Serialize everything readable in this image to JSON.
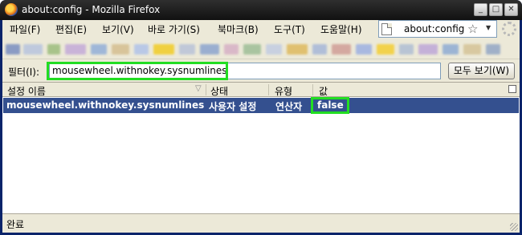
{
  "window": {
    "title": "about:config - Mozilla Firefox"
  },
  "menu": {
    "items": [
      "파일(F)",
      "편집(E)",
      "보기(V)",
      "바로 가기(S)",
      "북마크(B)",
      "도구(T)",
      "도움말(H)"
    ]
  },
  "urlbar": {
    "value": "about:config"
  },
  "filter": {
    "label": "필터(I):",
    "value": "mousewheel.withnokey.sysnumlines",
    "show_all_label": "모두 보기(W)"
  },
  "table": {
    "headers": [
      "설정 이름",
      "상태",
      "유형",
      "값"
    ],
    "rows": [
      {
        "name": "mousewheel.withnokey.sysnumlines",
        "status": "사용자 설정",
        "type": "연산자",
        "value": "false"
      }
    ]
  },
  "status": {
    "text": "완료"
  },
  "colors": {
    "selection": "#34508f",
    "highlight": "#22dd22",
    "chrome": "#ece9d8"
  }
}
